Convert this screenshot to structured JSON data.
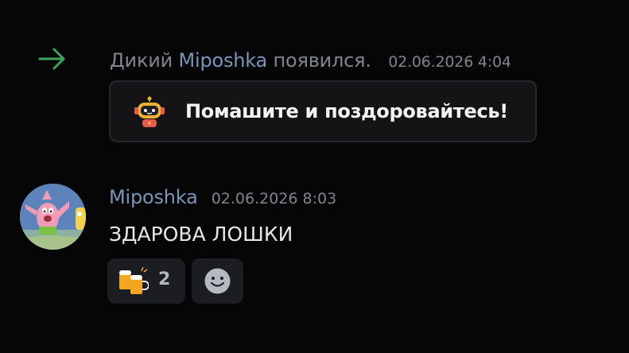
{
  "system_message": {
    "prefix": "Дикий ",
    "username": "Miposhka",
    "suffix": " появился.",
    "timestamp": "02.06.2026 4:04",
    "icon": "join-arrow-icon",
    "wave_button": {
      "label": "Помашите и поздоровайтесь!",
      "icon": "wave-robot-sticker"
    }
  },
  "message": {
    "author": "Miposhka",
    "timestamp": "02.06.2026 8:03",
    "content": "ЗДАРОВА ЛОШКИ",
    "avatar": "patrick-avatar",
    "reactions": [
      {
        "emoji": "beers-icon",
        "count": "2"
      }
    ],
    "add_reaction_icon": "smiley-icon"
  },
  "colors": {
    "background": "#060607",
    "username": "#7b93b7",
    "muted": "#80848e",
    "join_arrow": "#3ba55d",
    "panel": "#141416"
  }
}
